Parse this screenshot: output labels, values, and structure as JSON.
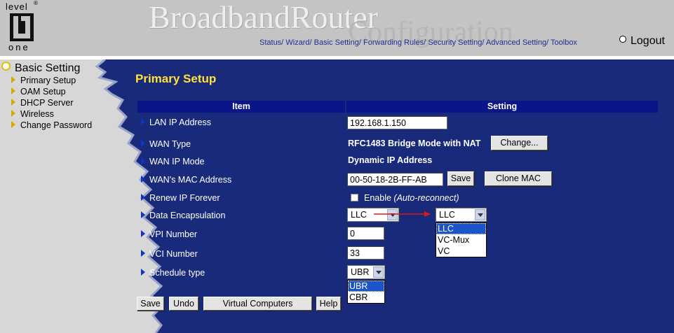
{
  "header": {
    "logo_top": "level",
    "logo_bottom": "one",
    "title_main": "BroadbandRouter",
    "title_sub": "Configuration",
    "nav": [
      "Status/",
      "Wizard/",
      "Basic Setting/",
      "Forwarding Rules/",
      "Security Setting/",
      "Advanced Setting/",
      "Toolbox"
    ],
    "logout": "Logout"
  },
  "sidebar": {
    "title": "Basic Setting",
    "items": [
      "Primary Setup",
      "OAM Setup",
      "DHCP Server",
      "Wireless",
      "Change Password"
    ]
  },
  "main": {
    "title": "Primary Setup",
    "col_item": "Item",
    "col_setting": "Setting",
    "rows": {
      "lan_ip": {
        "label": "LAN IP Address",
        "value": "192.168.1.150"
      },
      "wan_type": {
        "label": "WAN Type",
        "value": "RFC1483 Bridge Mode with NAT",
        "button": "Change..."
      },
      "wan_ip_mode": {
        "label": "WAN IP Mode",
        "value": "Dynamic IP Address"
      },
      "wan_mac": {
        "label": "WAN's MAC Address",
        "value": "00-50-18-2B-FF-AB",
        "save": "Save",
        "clone": "Clone MAC"
      },
      "renew": {
        "label": "Renew IP Forever",
        "enable": "Enable",
        "note": "(Auto-reconnect)"
      },
      "encap": {
        "label": "Data Encapsulation",
        "value": "LLC",
        "value2": "LLC",
        "options": [
          "LLC",
          "VC-Mux",
          "VC"
        ]
      },
      "vpi": {
        "label": "VPI Number",
        "value": "0"
      },
      "vci": {
        "label": "VCI Number",
        "value": "33"
      },
      "schedule": {
        "label": "Schedule type",
        "value": "UBR",
        "options": [
          "UBR",
          "CBR"
        ]
      }
    },
    "buttons": {
      "save": "Save",
      "undo": "Undo",
      "virtual": "Virtual Computers",
      "help": "Help"
    }
  },
  "colors": {
    "background": "#1a2a7a",
    "title": "#ffe23a",
    "header_gray": "#c4c4c4",
    "arrow": "#e01818"
  }
}
